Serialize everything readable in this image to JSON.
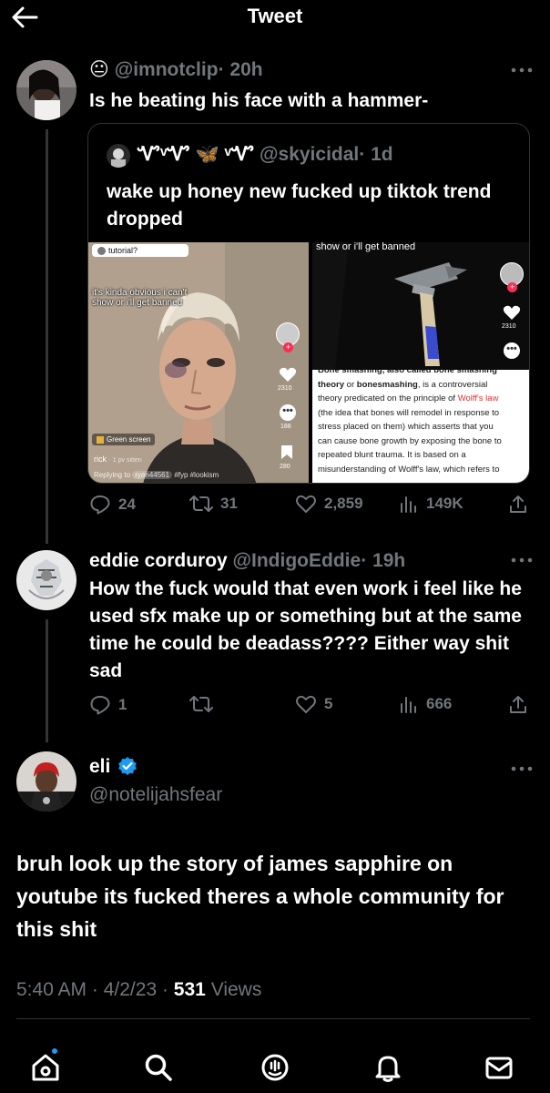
{
  "header": {
    "title": "Tweet"
  },
  "reply1": {
    "emoji": "😐",
    "handle": "@imnotclip",
    "time": "· 20h",
    "text": "Is he beating his face with a hammer-",
    "actions": {
      "replies": "24",
      "retweets": "31",
      "likes": "2,859",
      "views": "149K"
    }
  },
  "quote": {
    "display_name": "ᏉᵛᏉ 🦋 ᵛᏉ",
    "handle": "@skyicidal",
    "time": "· 1d",
    "text": "wake up honey new fucked up tiktok trend dropped",
    "left_media": {
      "tutorial_label": "tutorial?",
      "caption": "it's kinda obvious i can't show or i'll get banned",
      "likes": "2310",
      "comments": "188",
      "saves": "280",
      "green_screen": "Green screen",
      "username": "rick",
      "meta": "· 1 pv sitten",
      "replying": "Replying to",
      "reply_user": "ryan44561",
      "tags": "#fyp #lookism"
    },
    "right_media": {
      "caption": "show or i'll get banned",
      "likes": "2310",
      "wiki_heading": "Bone smashing, also called bone smashing",
      "wiki_line1a": "theory",
      "wiki_line1b": " or ",
      "wiki_line1c": "bonesmashing",
      "wiki_line1d": ", is a controversial",
      "wiki_line2a": "theory predicated on the principle of ",
      "wiki_line2b": "Wolff's law",
      "wiki_line3": "(the idea that bones will remodel in response to",
      "wiki_line4": "stress placed on them) which asserts that you",
      "wiki_line5": "can cause bone growth by exposing the bone to",
      "wiki_line6": "repeated blunt trauma. It is based on a",
      "wiki_line7": "misunderstanding of Wolff's law, which refers to"
    }
  },
  "reply2": {
    "display_name": "eddie corduroy",
    "handle": "@IndigoEddie",
    "time": "· 19h",
    "text": "How the fuck would that even work i feel like he used sfx make up or something but at the same time he could be deadass???? Either way shit sad",
    "actions": {
      "replies": "1",
      "retweets": "",
      "likes": "5",
      "views": "666"
    }
  },
  "main": {
    "display_name": "eli",
    "handle": "@notelijahsfear",
    "text": "bruh look up the story of james sapphire on youtube its fucked theres a whole community for this shit",
    "time": "5:40 AM",
    "date": "· 4/2/23 ·",
    "views_count": "531",
    "views_label": "Views"
  },
  "colors": {
    "accent": "#1d9bf0",
    "muted": "#71767b",
    "link": "#d33"
  },
  "icons": [
    "back-arrow-icon",
    "more-icon",
    "reply-icon",
    "retweet-icon",
    "like-icon",
    "views-icon",
    "share-icon",
    "verified-icon",
    "home-icon",
    "search-icon",
    "spaces-icon",
    "notifications-icon",
    "messages-icon"
  ]
}
